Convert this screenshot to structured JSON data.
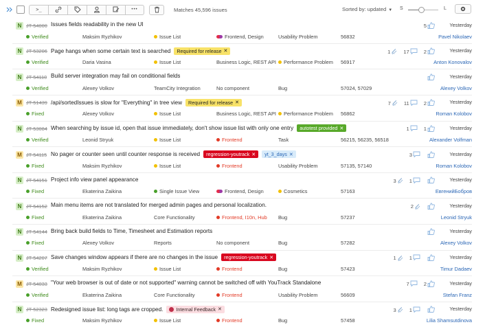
{
  "toolbar": {
    "matches": "Matches 45,596 issues",
    "sorted_by": "Sorted by: updated",
    "size_small": "S",
    "size_large": "L",
    "size_level": 0.45,
    "icons": [
      "collapse-icon",
      "checkbox-icon",
      "command-icon",
      "link-icon",
      "tag-icon",
      "user-icon",
      "edit-icon",
      "more-icon",
      "trash-icon",
      "settings-icon"
    ],
    "command_glyph": ">_",
    "more_glyph": "•••"
  },
  "colors": {
    "link": "#2a66b5",
    "fixed": "#49a02a",
    "frontend": "#e23a26",
    "issue_list": "#f2c000",
    "tag_yellow": "#f8e268",
    "tag_red": "#d9071f",
    "tag_green": "#58a92a",
    "tag_light_blue": "#d8ebfa",
    "tag_pink": "#fbdde1"
  },
  "issues": [
    {
      "priority": "N",
      "id": "JT-54000",
      "summary": "Issues fields readability in the new UI",
      "tags": [],
      "counts": [
        {
          "n": "5",
          "icon": "thumb"
        }
      ],
      "state": "Verified",
      "assignee_col2": "Maksim Ryzhikov",
      "subsystem": "Issue List",
      "subsystem_color": "#f2c000",
      "component": "Frontend, Design",
      "component_color": "dd",
      "type": "Usability Problem",
      "type_color": "",
      "fixed_in": "56832",
      "assignee": "Pavel Nikolaev",
      "updated": "Yesterday"
    },
    {
      "priority": "N",
      "id": "JT-53206",
      "summary": "Page hangs when some certain text is searched",
      "tags": [
        {
          "label": "Required for release",
          "style": "yellow"
        }
      ],
      "counts": [
        {
          "n": "1",
          "icon": "attach"
        },
        {
          "n": "17",
          "icon": "comment"
        },
        {
          "n": "2",
          "icon": "thumb"
        }
      ],
      "state": "Verified",
      "assignee_col2": "Daria Vasina",
      "subsystem": "Issue List",
      "subsystem_color": "#f2c000",
      "component": "Business Logic, REST API",
      "component_color": "",
      "type": "Performance Problem",
      "type_color": "#f2c000",
      "fixed_in": "56917",
      "assignee": "Anton Konovalov",
      "updated": "Yesterday"
    },
    {
      "priority": "N",
      "id": "JT-54110",
      "summary": "Build server integration may fail on conditional fields",
      "tags": [],
      "counts": [
        {
          "n": "",
          "icon": "thumb"
        }
      ],
      "state": "Verified",
      "assignee_col2": "Alexey Volkov",
      "subsystem": "TeamCity Integration",
      "subsystem_color": "",
      "component": "No component",
      "component_color": "",
      "type": "Bug",
      "type_color": "",
      "fixed_in": "57024, 57029",
      "assignee": "Alexey Volkov",
      "updated": "Yesterday"
    },
    {
      "priority": "M",
      "id": "JT-51439",
      "summary": "/api/sortedIssues is slow for \"Everything\" in tree view",
      "tags": [
        {
          "label": "Required for release",
          "style": "yellow"
        }
      ],
      "counts": [
        {
          "n": "7",
          "icon": "attach"
        },
        {
          "n": "11",
          "icon": "comment"
        },
        {
          "n": "2",
          "icon": "thumb"
        }
      ],
      "state": "Fixed",
      "assignee_col2": "Alexey Volkov",
      "subsystem": "Issue List",
      "subsystem_color": "#f2c000",
      "component": "Business Logic, REST API",
      "component_color": "",
      "type": "Performance Problem",
      "type_color": "#f2c000",
      "fixed_in": "56862",
      "assignee": "Roman Kolobov",
      "updated": "Yesterday"
    },
    {
      "priority": "N",
      "id": "JT-53084",
      "summary": "When searching by issue id, open that issue immediately, don't show issue list with only one entry",
      "tags": [
        {
          "label": "autotest provided",
          "style": "green"
        }
      ],
      "counts": [
        {
          "n": "1",
          "icon": "comment"
        },
        {
          "n": "1",
          "icon": "thumb"
        }
      ],
      "state": "Verified",
      "assignee_col2": "Leonid Stryuk",
      "subsystem": "Issue List",
      "subsystem_color": "#f2c000",
      "component": "Frontend",
      "component_color": "#e23a26",
      "type": "Task",
      "type_color": "",
      "fixed_in": "56215, 56235, 56518",
      "assignee": "Alexander Volfman",
      "updated": "Yesterday"
    },
    {
      "priority": "M",
      "id": "JT-54115",
      "summary": "No pager or counter seen until counter response is received",
      "tags": [
        {
          "label": "regression-youtrack",
          "style": "red"
        },
        {
          "label": "yt_3_days",
          "style": "lightblue"
        }
      ],
      "counts": [
        {
          "n": "3",
          "icon": "comment"
        },
        {
          "n": "",
          "icon": "thumb"
        }
      ],
      "state": "Fixed",
      "assignee_col2": "Maksim Ryzhikov",
      "subsystem": "Issue List",
      "subsystem_color": "#f2c000",
      "component": "Frontend",
      "component_color": "#e23a26",
      "type": "Usability Problem",
      "type_color": "",
      "fixed_in": "57135, 57140",
      "assignee": "Roman Kolobov",
      "updated": "Yesterday"
    },
    {
      "priority": "N",
      "id": "JT-54151",
      "summary": "Project info view panel appearance",
      "tags": [],
      "counts": [
        {
          "n": "3",
          "icon": "attach"
        },
        {
          "n": "1",
          "icon": "comment"
        },
        {
          "n": "",
          "icon": "thumb"
        }
      ],
      "state": "Fixed",
      "assignee_col2": "Ekaterina Zaikina",
      "subsystem": "Single Issue View",
      "subsystem_color": "#49a02a",
      "component": "Frontend, Design",
      "component_color": "dd",
      "type": "Cosmetics",
      "type_color": "#f2c000",
      "fixed_in": "57163",
      "assignee": "ЕвгенийБобров",
      "updated": "Yesterday"
    },
    {
      "priority": "N",
      "id": "JT-54152",
      "summary": "Main menu items are not translated for merged admin pages and personal localization.",
      "tags": [],
      "counts": [
        {
          "n": "2",
          "icon": "attach"
        },
        {
          "n": "",
          "icon": "thumb"
        }
      ],
      "state": "Fixed",
      "assignee_col2": "Ekaterina Zaikina",
      "subsystem": "Core Functionality",
      "subsystem_color": "",
      "component": "Frontend, I10n, Hub",
      "component_color": "#e23a26",
      "type": "Bug",
      "type_color": "",
      "fixed_in": "57237",
      "assignee": "Leonid Stryuk",
      "updated": "Yesterday"
    },
    {
      "priority": "N",
      "id": "JT-54144",
      "summary": "Bring back build fields to Time, Timesheet and Estimation reports",
      "tags": [],
      "counts": [
        {
          "n": "",
          "icon": "thumb"
        }
      ],
      "state": "Fixed",
      "assignee_col2": "Alexey Volkov",
      "subsystem": "Reports",
      "subsystem_color": "",
      "component": "No component",
      "component_color": "",
      "type": "Bug",
      "type_color": "",
      "fixed_in": "57282",
      "assignee": "Alexey Volkov",
      "updated": "Yesterday"
    },
    {
      "priority": "N",
      "id": "JT-54207",
      "summary": "Save changes window appears if there are no changes in the issue",
      "tags": [
        {
          "label": "regression-youtrack",
          "style": "red"
        }
      ],
      "counts": [
        {
          "n": "1",
          "icon": "attach"
        },
        {
          "n": "1",
          "icon": "comment"
        },
        {
          "n": "",
          "icon": "thumb"
        }
      ],
      "state": "Verified",
      "assignee_col2": "Maksim Ryzhikov",
      "subsystem": "Issue List",
      "subsystem_color": "#f2c000",
      "component": "Frontend",
      "component_color": "#e23a26",
      "type": "Bug",
      "type_color": "",
      "fixed_in": "57423",
      "assignee": "Timur Dadaev",
      "updated": "Yesterday"
    },
    {
      "priority": "M",
      "id": "JT-54033",
      "summary": "\"Your web browser is out of date or not supported\" warning cannot be switched off with YouTrack Standalone",
      "tags": [],
      "counts": [
        {
          "n": "7",
          "icon": "comment"
        },
        {
          "n": "2",
          "icon": "thumb"
        }
      ],
      "state": "Verified",
      "assignee_col2": "Ekaterina Zaikina",
      "subsystem": "Core Functionality",
      "subsystem_color": "",
      "component": "Frontend",
      "component_color": "#e23a26",
      "type": "Usability Problem",
      "type_color": "",
      "fixed_in": "56609",
      "assignee": "Stefan Franz",
      "updated": "Yesterday"
    },
    {
      "priority": "N",
      "id": "JT-52323",
      "summary": "Redesigned issue list: long tags are cropped.",
      "tags": [
        {
          "label": "Internal Feedback",
          "style": "pink"
        }
      ],
      "counts": [
        {
          "n": "3",
          "icon": "attach"
        },
        {
          "n": "1",
          "icon": "comment"
        },
        {
          "n": "",
          "icon": "thumb"
        }
      ],
      "state": "Fixed",
      "assignee_col2": "Maksim Ryzhikov",
      "subsystem": "Issue List",
      "subsystem_color": "#f2c000",
      "component": "Frontend",
      "component_color": "#e23a26",
      "type": "Bug",
      "type_color": "",
      "fixed_in": "57458",
      "assignee": "Lilia Shamsutdinova",
      "updated": "Yesterday"
    }
  ]
}
